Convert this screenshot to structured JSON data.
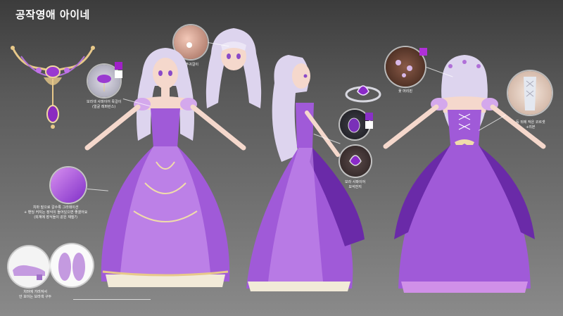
{
  "header": {
    "title": "공작영애 아이네"
  },
  "colors": {
    "gown_main": "#a05ad8",
    "gown_light": "#c890ee",
    "gown_dark": "#6a2aa8",
    "hair": "#ddd8ec",
    "skin": "#f5d8cc",
    "gold": "#e8c98a",
    "swatch_purple": "#a020c8",
    "swatch_pink": "#e68cf0",
    "swatch_white": "#ffffff"
  },
  "notes": {
    "necklace": [
      "보라색 사파이어 목걸이",
      "(얼굴 레퍼런스)"
    ],
    "earring": "진주귀걸이",
    "hair_ornament": "꽃 머리핀",
    "back_ribbon": [
      "등 뒤에 작은 코르셋",
      "+리본"
    ],
    "gradient": [
      "치마 밑으로 갈수록 그라데이션",
      "+ 밴딩 커지는 장식이 들어있으면 좋겠어요",
      "(외계에 장식들이 같은 재질?)"
    ],
    "ring": [
      "보라 사파이어",
      "보석반지"
    ],
    "shoes": [
      "치마에 가려져서",
      "안 보이는 보라색 구두"
    ]
  },
  "icons": [
    "necklace-icon",
    "earring-icon",
    "hair-pin-icon",
    "ring-icon",
    "shoe-icon",
    "corset-icon"
  ]
}
